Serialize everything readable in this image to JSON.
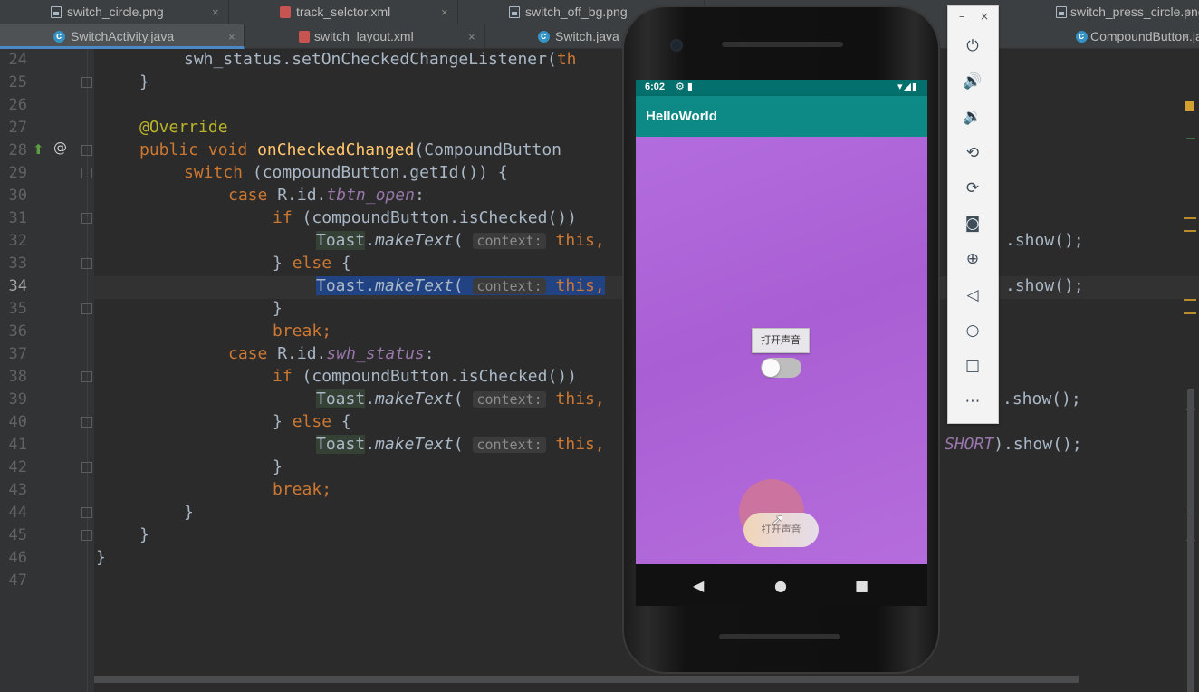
{
  "tabs_row1": [
    {
      "label": "switch_circle.png",
      "icon": "image-file-icon"
    },
    {
      "label": "track_selctor.xml",
      "icon": "xml-file-icon"
    },
    {
      "label": "switch_off_bg.png",
      "icon": "image-file-icon"
    },
    {
      "label": "switch_press_circle.png",
      "icon": "image-file-icon"
    }
  ],
  "tabs_row2": [
    {
      "label": "SwitchActivity.java",
      "icon": "class-file-icon"
    },
    {
      "label": "switch_layout.xml",
      "icon": "xml-file-icon"
    },
    {
      "label": "Switch.java",
      "icon": "class-file-icon"
    },
    {
      "label": "CompoundButton.java",
      "icon": "class-file-icon"
    }
  ],
  "close_glyph": "×",
  "line_numbers": [
    "24",
    "25",
    "26",
    "27",
    "28",
    "29",
    "30",
    "31",
    "32",
    "33",
    "34",
    "35",
    "36",
    "37",
    "38",
    "39",
    "40",
    "41",
    "42",
    "43",
    "44",
    "45",
    "46",
    "47"
  ],
  "code": {
    "l24": {
      "a": "swh_status.setOnCheckedChangeListener(",
      "b": "th"
    },
    "l25": "}",
    "l27": "@Override",
    "l28": {
      "kw1": "public",
      "kw2": "void",
      "fn": "onCheckedChanged",
      "rest": "(CompoundButton"
    },
    "l29": {
      "kw": "switch",
      "rest": " (compoundButton.getId()) {"
    },
    "l30": {
      "kw": "case",
      "pre": " R.id.",
      "id": "tbtn_open",
      "post": ":"
    },
    "l31": {
      "kw": "if",
      "rest": " (compoundButton.isChecked())"
    },
    "l32": {
      "cls": "Toast",
      "dot": ".",
      "m": "makeText",
      "p": "(",
      "hint": "context:",
      "kw": "this",
      "c": ","
    },
    "l33": {
      "a": "} ",
      "kw": "else",
      "b": " {"
    },
    "l34": {
      "cls": "Toast",
      "dot": ".",
      "m": "makeText",
      "p": "(",
      "hint": "context:",
      "kw": "this",
      "c": ","
    },
    "l35": "}",
    "l36": {
      "kw": "break",
      "semi": ";"
    },
    "l37": {
      "kw": "case",
      "pre": " R.id.",
      "id": "swh_status",
      "post": ":"
    },
    "l38": {
      "kw": "if",
      "rest": " (compoundButton.isChecked())"
    },
    "l39": {
      "cls": "Toast",
      "dot": ".",
      "m": "makeText",
      "p": "(",
      "hint": "context:",
      "kw": "this",
      "c": ","
    },
    "l40": {
      "a": "} ",
      "kw": "else",
      "b": " {"
    },
    "l41": {
      "cls": "Toast",
      "dot": ".",
      "m": "makeText",
      "p": "(",
      "hint": "context:",
      "kw": "this",
      "c": ","
    },
    "l42": "}",
    "l43": {
      "kw": "break",
      "semi": ";"
    },
    "l44": "}",
    "l45": "}",
    "l46": "}",
    "tail32": ".show();",
    "tail34": ".show();",
    "tail39": ".show();",
    "tail41_const": "SHORT",
    "tail41": ").show();"
  },
  "gutter_at": "@",
  "phone": {
    "status_time": "6:02",
    "status_icons": "⚙ ▮",
    "status_right": "▾◢▮",
    "app_title": "HelloWorld",
    "button_label": "打开声音",
    "pill_button_label": "打开声音",
    "switch_checked": false
  },
  "emulator": {
    "minimize": "–",
    "close": "×",
    "power_glyph": "⏻",
    "vol_up_glyph": "🔊",
    "vol_down_glyph": "🔉",
    "rotate_left_glyph": "⟲",
    "rotate_right_glyph": "⟳",
    "camera_glyph": "◙",
    "zoom_glyph": "⊕",
    "back_glyph": "◁",
    "home_glyph": "○",
    "overview_glyph": "□",
    "more_glyph": "⋯"
  },
  "nav": {
    "back": "◀",
    "home": "●",
    "recent": "■"
  },
  "colors": {
    "accent": "#4a88c7",
    "keyword": "#cc7832",
    "annotation": "#bbb529",
    "method_decl": "#ffc66d",
    "field": "#9876aa",
    "selection": "#214283",
    "app_bar": "#0e8a86",
    "screen_bg": "#b169dc"
  }
}
